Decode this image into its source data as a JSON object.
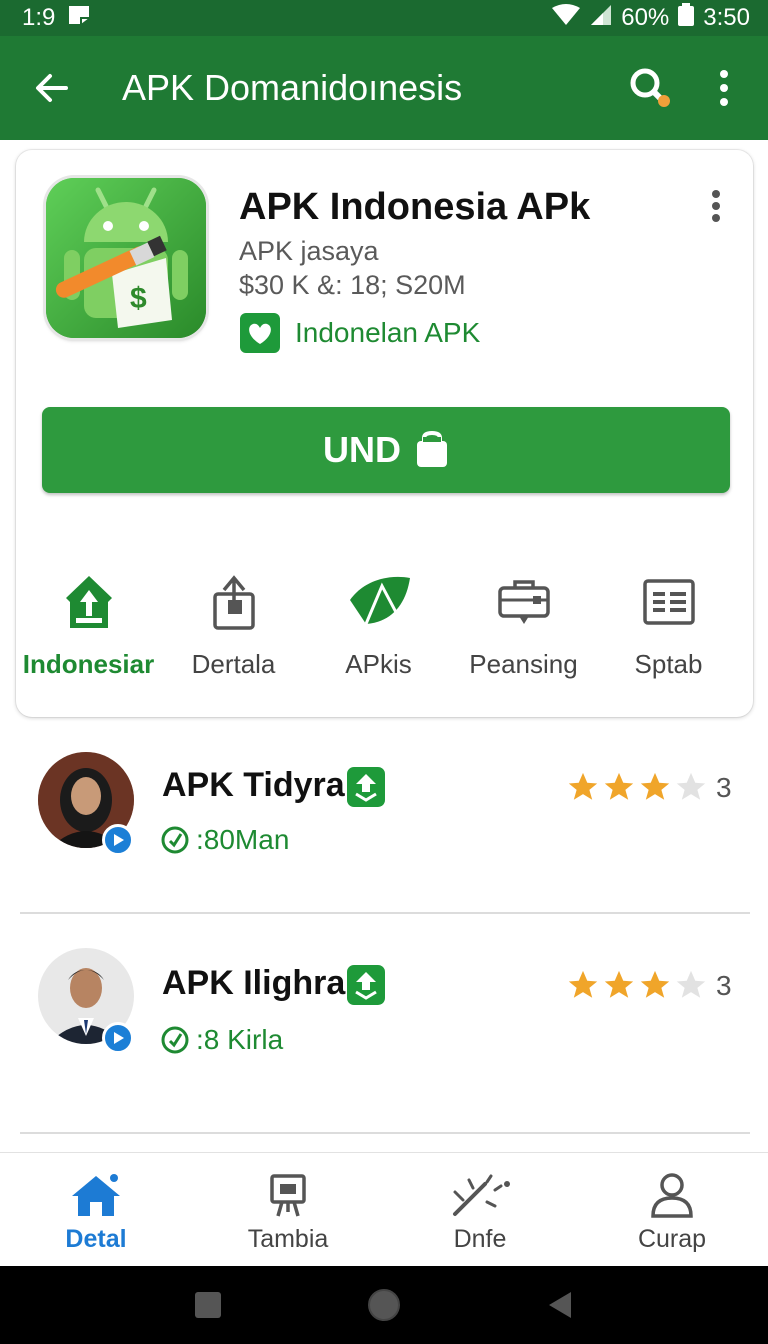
{
  "status_bar": {
    "time_left": "1:9",
    "battery": "60%",
    "time_right": "3:50"
  },
  "app_bar": {
    "title": "APK Domanidoınesis"
  },
  "app": {
    "name": "APK Indonesia APk",
    "developer": "APK jasaya",
    "meta": "$30 K &: 18; S20M",
    "badge_text": "Indonelan APK",
    "install_label": "UND"
  },
  "actions": [
    {
      "label": "Indonesiar",
      "icon": "home-arrow-icon",
      "active": true
    },
    {
      "label": "Dertala",
      "icon": "share-icon",
      "active": false
    },
    {
      "label": "APkis",
      "icon": "leaf-icon",
      "active": false
    },
    {
      "label": "Peansing",
      "icon": "briefcase-icon",
      "active": false
    },
    {
      "label": "Sptab",
      "icon": "list-icon",
      "active": false
    }
  ],
  "reviews": [
    {
      "name": "APK Tidyra",
      "sub": ":80Man",
      "rating": 3,
      "count": "3"
    },
    {
      "name": "APK Ilighra",
      "sub": ":8 Kirla",
      "rating": 3,
      "count": "3"
    }
  ],
  "bottom_nav": [
    {
      "label": "Detal",
      "icon": "home-icon",
      "active": true
    },
    {
      "label": "Tambia",
      "icon": "easel-icon",
      "active": false
    },
    {
      "label": "Dnfe",
      "icon": "magic-wand-icon",
      "active": false
    },
    {
      "label": "Curap",
      "icon": "person-icon",
      "active": false
    }
  ],
  "colors": {
    "primary": "#1f7a34",
    "status_bar": "#1b6a30",
    "accent_green": "#2e9a3e",
    "nav_active": "#1d7bd4",
    "star": "#f0a52a"
  }
}
